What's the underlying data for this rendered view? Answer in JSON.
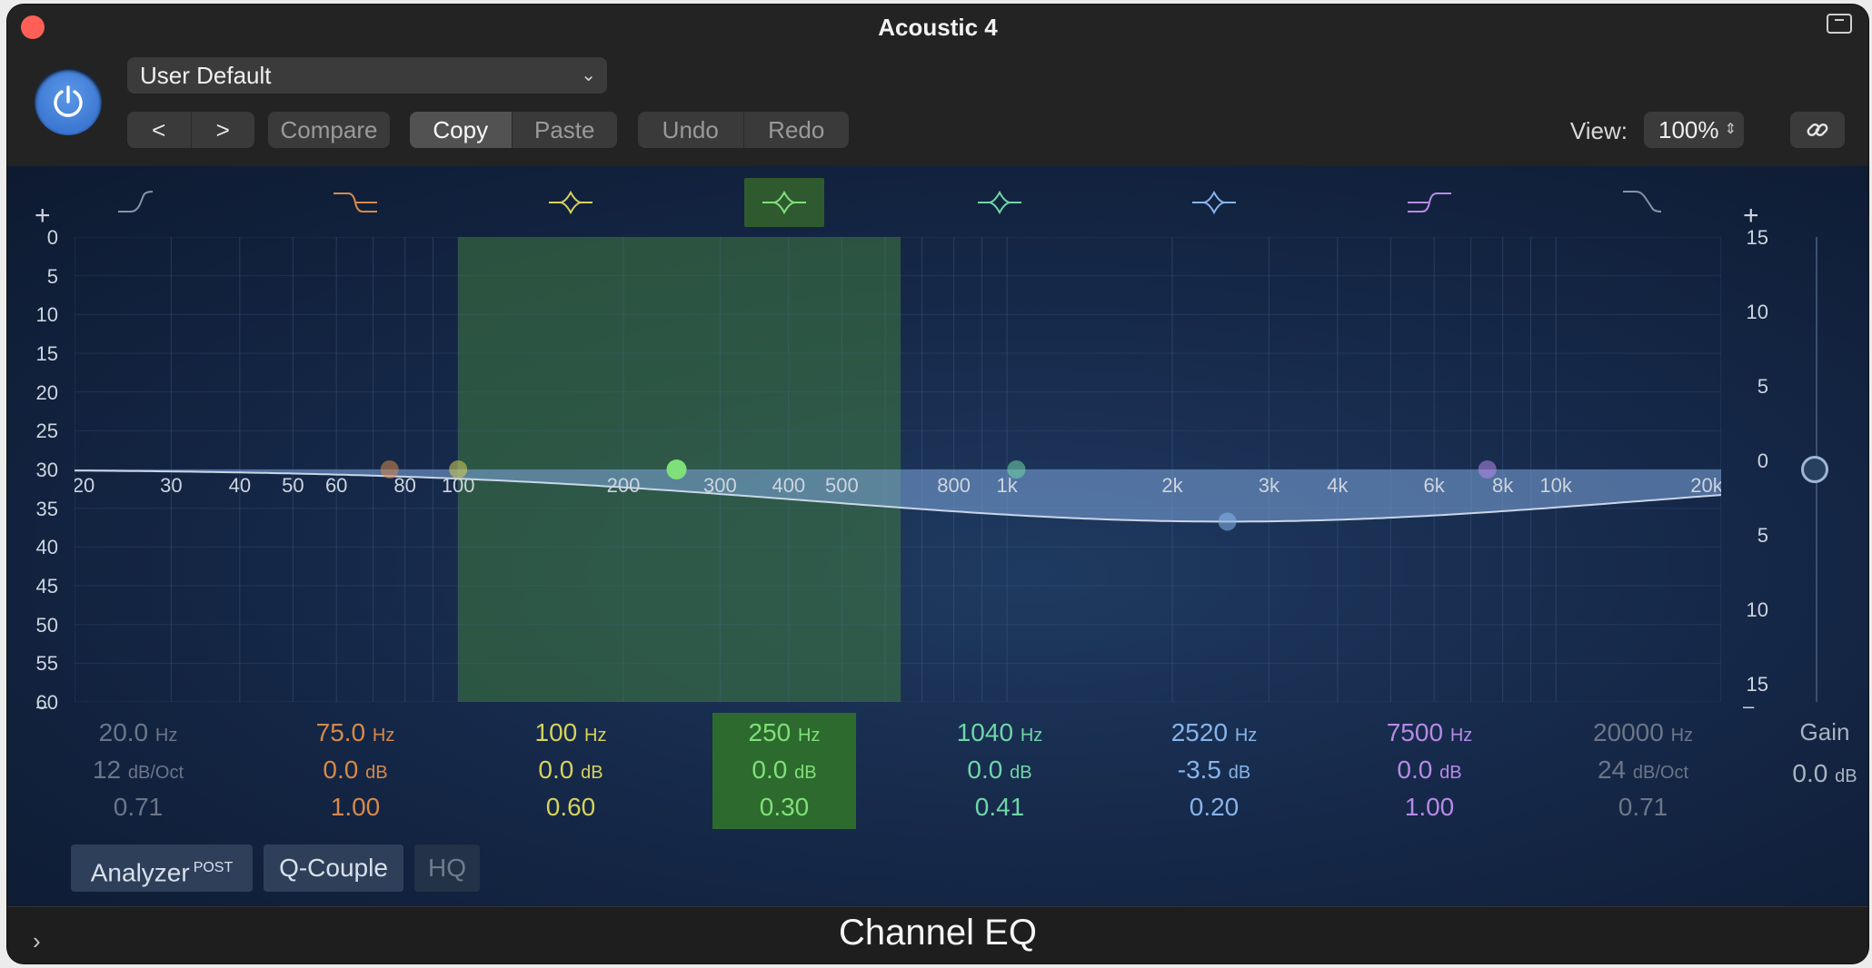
{
  "window": {
    "title": "Acoustic 4"
  },
  "toolbar": {
    "preset": "User Default",
    "prev_label": "<",
    "next_label": ">",
    "compare": "Compare",
    "copy": "Copy",
    "paste": "Paste",
    "undo": "Undo",
    "redo": "Redo",
    "view_label": "View:",
    "view_value": "100%"
  },
  "graph": {
    "plus_left": "+",
    "plus_right": "+",
    "minus_left": "–",
    "minus_right": "–",
    "left_scale": [
      "0",
      "5",
      "10",
      "15",
      "20",
      "25",
      "30",
      "35",
      "40",
      "45",
      "50",
      "55",
      "60"
    ],
    "right_scale": [
      "15",
      "10",
      "5",
      "0",
      "5",
      "10",
      "15"
    ],
    "freq_labels": [
      "20",
      "30",
      "40",
      "50",
      "60",
      "80",
      "100",
      "200",
      "300",
      "400",
      "500",
      "800",
      "1k",
      "2k",
      "3k",
      "4k",
      "6k",
      "8k",
      "10k",
      "20k"
    ],
    "selected_band_index": 3
  },
  "bands": [
    {
      "freq": "20.0",
      "freq_unit": "Hz",
      "gain": "12",
      "gain_unit": "dB/Oct",
      "q": "0.71",
      "color": "#8a93a3",
      "shape": "lowcut"
    },
    {
      "freq": "75.0",
      "freq_unit": "Hz",
      "gain": "0.0",
      "gain_unit": "dB",
      "q": "1.00",
      "color": "#d7894a",
      "shape": "lowshelf"
    },
    {
      "freq": "100",
      "freq_unit": "Hz",
      "gain": "0.0",
      "gain_unit": "dB",
      "q": "0.60",
      "color": "#d6d25a",
      "shape": "bell"
    },
    {
      "freq": "250",
      "freq_unit": "Hz",
      "gain": "0.0",
      "gain_unit": "dB",
      "q": "0.30",
      "color": "#7fe07a",
      "shape": "bell"
    },
    {
      "freq": "1040",
      "freq_unit": "Hz",
      "gain": "0.0",
      "gain_unit": "dB",
      "q": "0.41",
      "color": "#6fd6a8",
      "shape": "bell"
    },
    {
      "freq": "2520",
      "freq_unit": "Hz",
      "gain": "-3.5",
      "gain_unit": "dB",
      "q": "0.20",
      "color": "#86b4ea",
      "shape": "bell"
    },
    {
      "freq": "7500",
      "freq_unit": "Hz",
      "gain": "0.0",
      "gain_unit": "dB",
      "q": "1.00",
      "color": "#b68ae6",
      "shape": "highshelf"
    },
    {
      "freq": "20000",
      "freq_unit": "Hz",
      "gain": "24",
      "gain_unit": "dB/Oct",
      "q": "0.71",
      "color": "#8a93a3",
      "shape": "highcut"
    }
  ],
  "gain": {
    "label": "Gain",
    "value": "0.0",
    "unit": "dB"
  },
  "options": {
    "analyzer": "Analyzer",
    "analyzer_badge": "POST",
    "qcouple": "Q-Couple",
    "hq": "HQ"
  },
  "footer": {
    "plugin_name": "Channel EQ",
    "expand": "›"
  }
}
